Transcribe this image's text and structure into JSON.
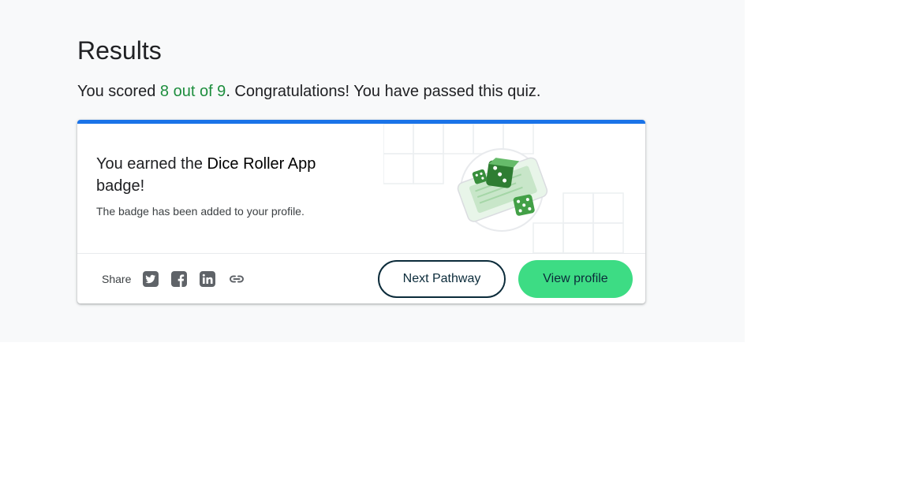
{
  "results": {
    "title": "Results",
    "score_prefix": "You scored ",
    "score_value": "8 out of 9",
    "score_suffix": ". Congratulations! You have passed this quiz."
  },
  "badge_card": {
    "heading_prefix": "You earned the ",
    "badge_name": "Dice Roller App",
    "heading_suffix": " badge!",
    "subtitle": "The badge has been added to your profile.",
    "accent_color": "#1a73e8"
  },
  "share": {
    "label": "Share",
    "icons": [
      "twitter-icon",
      "facebook-icon",
      "linkedin-icon",
      "link-icon"
    ]
  },
  "actions": {
    "next_label": "Next Pathway",
    "profile_label": "View profile",
    "profile_color": "#3ddc84"
  }
}
